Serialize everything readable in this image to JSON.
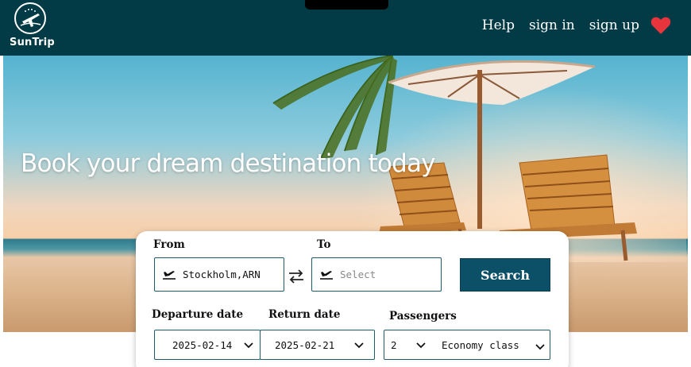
{
  "header": {
    "logo_text": "SunTrip",
    "nav": {
      "help": "Help",
      "sign_in": "sign in",
      "sign_up": "sign up"
    },
    "heart_icon": "heart-icon",
    "colors": {
      "background": "#023a45",
      "heart": "#e8353d"
    }
  },
  "hero": {
    "title": "Book your dream destination today"
  },
  "booking": {
    "from_label": "From",
    "to_label": "To",
    "from_value": "Stockholm,ARN",
    "to_placeholder": "Select",
    "search_label": "Search",
    "departure_label": "Departure date",
    "return_label": "Return date",
    "passengers_label": "Passengers",
    "departure_value": "2025-02-14",
    "return_value": "2025-02-21",
    "passengers_value": "2",
    "class_value": "Economy class",
    "colors": {
      "search_button": "#0c5068",
      "field_border": "#1d5a6a"
    }
  }
}
